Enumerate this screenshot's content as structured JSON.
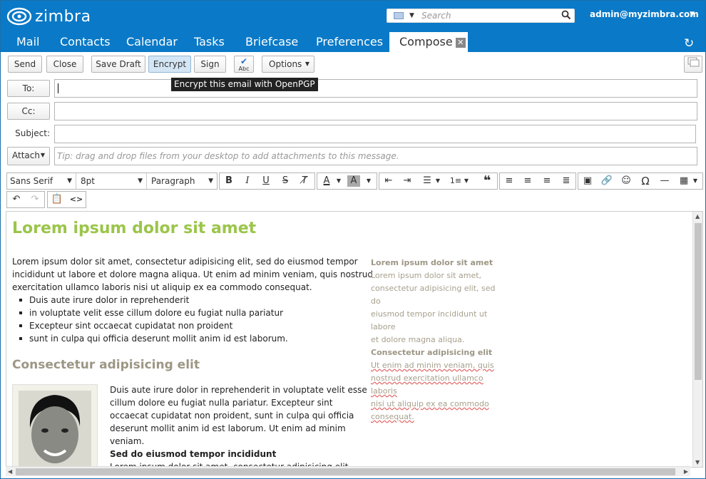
{
  "header": {
    "logo_text": "zimbra",
    "search_placeholder": "Search",
    "user": "admin@myzimbra.com"
  },
  "nav": {
    "tabs": [
      "Mail",
      "Contacts",
      "Calendar",
      "Tasks",
      "Briefcase",
      "Preferences",
      "Compose"
    ]
  },
  "toolbar": {
    "send": "Send",
    "close": "Close",
    "save_draft": "Save Draft",
    "encrypt": "Encrypt",
    "sign": "Sign",
    "spell": "Abc",
    "options": "Options",
    "encrypt_tooltip": "Encrypt this email with OpenPGP"
  },
  "fields": {
    "to": "To:",
    "cc": "Cc:",
    "subject": "Subject:",
    "attach": "Attach",
    "attach_tip": "Tip: drag and drop files from your desktop to add attachments to this message."
  },
  "editor": {
    "font": "Sans Serif",
    "size": "8pt",
    "block": "Paragraph"
  },
  "body": {
    "title": "Lorem ipsum dolor sit amet",
    "para1_l1": "Lorem ipsum dolor sit amet, consectetur adipisicing elit, sed do eiusmod tempor",
    "para1_l2": "incididunt ut labore et dolore magna aliqua. Ut enim ad minim veniam, quis nostrud",
    "para1_l3": "exercitation ullamco laboris nisi ut aliquip ex ea commodo consequat.",
    "bullets": [
      "Duis aute irure dolor in reprehenderit",
      "in voluptate velit esse cillum dolore eu fugiat nulla pariatur",
      "Excepteur sint occaecat cupidatat non proident",
      "sunt in culpa qui officia deserunt mollit anim id est laborum."
    ],
    "subtitle": "Consectetur adipisicing elit",
    "para2": [
      "Duis aute irure dolor in reprehenderit in voluptate velit esse",
      "cillum dolore eu fugiat nulla pariatur. Excepteur sint",
      "occaecat cupidatat non proident, sunt in culpa qui officia",
      "deserunt mollit anim id est laborum. Ut enim ad minim",
      "veniam."
    ],
    "bold_line": "Sed do eiusmod tempor incididunt",
    "cut_line": "Lorem ipsum dolor sit amet, consectetur adipisicing elit",
    "side_title": "Lorem ipsum dolor sit amet",
    "side_lines": [
      "Lorem ipsum dolor sit amet,",
      "consectetur adipisicing elit, sed do",
      "eiusmod tempor incididunt ut labore",
      "et dolore magna aliqua."
    ],
    "side_title2": "Consectetur adipisicing elit",
    "side_lines2": [
      "Ut enim ad minim veniam, quis",
      "nostrud exercitation ullamco laboris",
      "nisi ut aliquip ex ea commodo",
      "consequat."
    ]
  }
}
